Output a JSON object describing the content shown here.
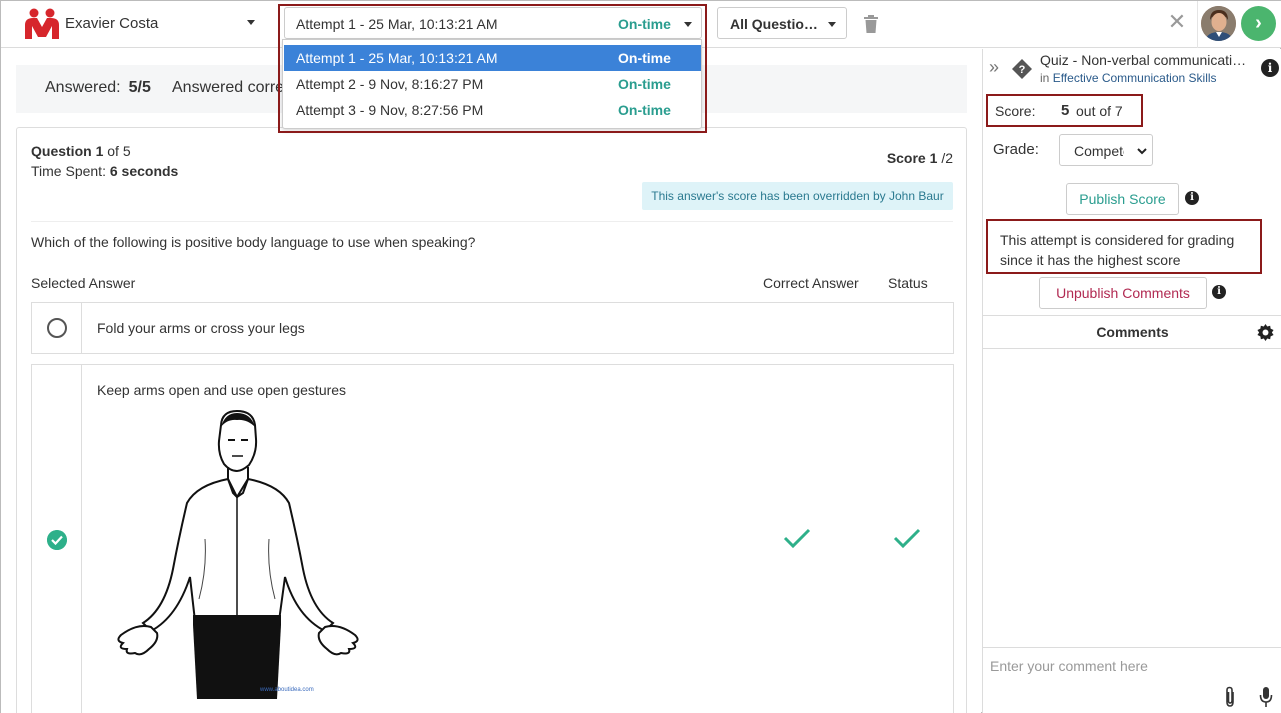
{
  "header": {
    "student_name": "Exavier Costa",
    "attempt_selected_label": "Attempt 1 - 25 Mar, 10:13:21 AM",
    "attempt_selected_status": "On-time",
    "question_filter": "All Questio…",
    "close_icon": "close-icon",
    "next_icon": "chevron-right-icon"
  },
  "attempts": [
    {
      "label": "Attempt 1 - 25 Mar, 10:13:21 AM",
      "status": "On-time",
      "selected": true
    },
    {
      "label": "Attempt 2 - 9 Nov, 8:16:27 PM",
      "status": "On-time",
      "selected": false
    },
    {
      "label": "Attempt 3 - 9 Nov, 8:27:56 PM",
      "status": "On-time",
      "selected": false
    }
  ],
  "summary": {
    "answered_label": "Answered:",
    "answered_value": "5/5",
    "answered_correct_label": "Answered corre"
  },
  "question": {
    "number_label": "Question",
    "number": "1",
    "of_label": "of 5",
    "time_label": "Time Spent:",
    "time_value": "6 seconds",
    "score_label": "Score",
    "score_value": "1",
    "score_max": "/2",
    "override_note": "This answer's score has been overridden by John Baur",
    "text": "Which of the following is positive body language to use when speaking?",
    "col_selected": "Selected Answer",
    "col_correct": "Correct Answer",
    "col_status": "Status",
    "options": [
      {
        "text": "Fold your arms or cross your legs",
        "selected": false
      },
      {
        "text": "Keep arms open and use open gestures",
        "selected": true
      }
    ],
    "image_caption": "www.aboutidea.com"
  },
  "panel": {
    "quiz_title": "Quiz - Non-verbal communicati…",
    "quiz_in": "in",
    "quiz_course": "Effective Communication Skills",
    "score_label": "Score:",
    "score_value": "5",
    "score_of": "out of 7",
    "grade_label": "Grade:",
    "grade_value": "Competent",
    "publish_score": "Publish Score",
    "grading_note": "This attempt is considered for grading since it has the highest score",
    "unpublish_comments": "Unpublish Comments",
    "comments_title": "Comments",
    "comment_placeholder": "Enter your comment here"
  },
  "colors": {
    "accent_teal": "#2a9d8f",
    "selected_blue": "#3b82d8",
    "highlight_red": "#8b1a1a",
    "unpublish_red": "#b12a52",
    "next_green": "#4bb56e"
  }
}
